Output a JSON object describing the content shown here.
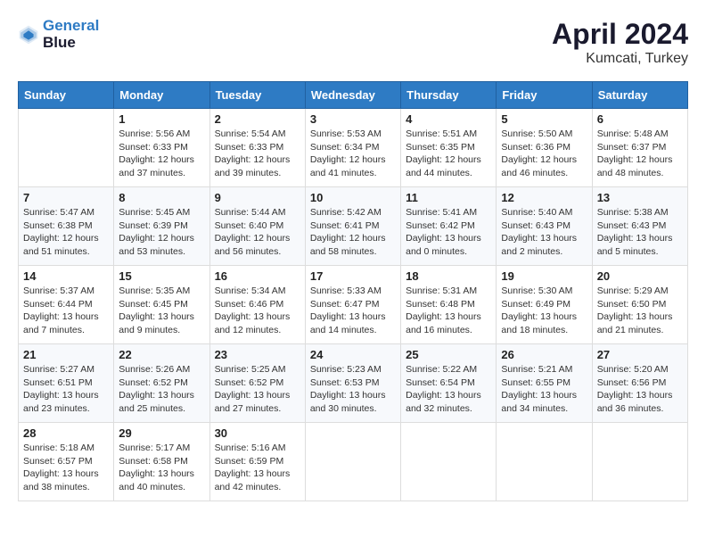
{
  "header": {
    "logo_line1": "General",
    "logo_line2": "Blue",
    "month": "April 2024",
    "location": "Kumcati, Turkey"
  },
  "weekdays": [
    "Sunday",
    "Monday",
    "Tuesday",
    "Wednesday",
    "Thursday",
    "Friday",
    "Saturday"
  ],
  "weeks": [
    [
      {
        "day": "",
        "info": ""
      },
      {
        "day": "1",
        "info": "Sunrise: 5:56 AM\nSunset: 6:33 PM\nDaylight: 12 hours\nand 37 minutes."
      },
      {
        "day": "2",
        "info": "Sunrise: 5:54 AM\nSunset: 6:33 PM\nDaylight: 12 hours\nand 39 minutes."
      },
      {
        "day": "3",
        "info": "Sunrise: 5:53 AM\nSunset: 6:34 PM\nDaylight: 12 hours\nand 41 minutes."
      },
      {
        "day": "4",
        "info": "Sunrise: 5:51 AM\nSunset: 6:35 PM\nDaylight: 12 hours\nand 44 minutes."
      },
      {
        "day": "5",
        "info": "Sunrise: 5:50 AM\nSunset: 6:36 PM\nDaylight: 12 hours\nand 46 minutes."
      },
      {
        "day": "6",
        "info": "Sunrise: 5:48 AM\nSunset: 6:37 PM\nDaylight: 12 hours\nand 48 minutes."
      }
    ],
    [
      {
        "day": "7",
        "info": "Sunrise: 5:47 AM\nSunset: 6:38 PM\nDaylight: 12 hours\nand 51 minutes."
      },
      {
        "day": "8",
        "info": "Sunrise: 5:45 AM\nSunset: 6:39 PM\nDaylight: 12 hours\nand 53 minutes."
      },
      {
        "day": "9",
        "info": "Sunrise: 5:44 AM\nSunset: 6:40 PM\nDaylight: 12 hours\nand 56 minutes."
      },
      {
        "day": "10",
        "info": "Sunrise: 5:42 AM\nSunset: 6:41 PM\nDaylight: 12 hours\nand 58 minutes."
      },
      {
        "day": "11",
        "info": "Sunrise: 5:41 AM\nSunset: 6:42 PM\nDaylight: 13 hours\nand 0 minutes."
      },
      {
        "day": "12",
        "info": "Sunrise: 5:40 AM\nSunset: 6:43 PM\nDaylight: 13 hours\nand 2 minutes."
      },
      {
        "day": "13",
        "info": "Sunrise: 5:38 AM\nSunset: 6:43 PM\nDaylight: 13 hours\nand 5 minutes."
      }
    ],
    [
      {
        "day": "14",
        "info": "Sunrise: 5:37 AM\nSunset: 6:44 PM\nDaylight: 13 hours\nand 7 minutes."
      },
      {
        "day": "15",
        "info": "Sunrise: 5:35 AM\nSunset: 6:45 PM\nDaylight: 13 hours\nand 9 minutes."
      },
      {
        "day": "16",
        "info": "Sunrise: 5:34 AM\nSunset: 6:46 PM\nDaylight: 13 hours\nand 12 minutes."
      },
      {
        "day": "17",
        "info": "Sunrise: 5:33 AM\nSunset: 6:47 PM\nDaylight: 13 hours\nand 14 minutes."
      },
      {
        "day": "18",
        "info": "Sunrise: 5:31 AM\nSunset: 6:48 PM\nDaylight: 13 hours\nand 16 minutes."
      },
      {
        "day": "19",
        "info": "Sunrise: 5:30 AM\nSunset: 6:49 PM\nDaylight: 13 hours\nand 18 minutes."
      },
      {
        "day": "20",
        "info": "Sunrise: 5:29 AM\nSunset: 6:50 PM\nDaylight: 13 hours\nand 21 minutes."
      }
    ],
    [
      {
        "day": "21",
        "info": "Sunrise: 5:27 AM\nSunset: 6:51 PM\nDaylight: 13 hours\nand 23 minutes."
      },
      {
        "day": "22",
        "info": "Sunrise: 5:26 AM\nSunset: 6:52 PM\nDaylight: 13 hours\nand 25 minutes."
      },
      {
        "day": "23",
        "info": "Sunrise: 5:25 AM\nSunset: 6:52 PM\nDaylight: 13 hours\nand 27 minutes."
      },
      {
        "day": "24",
        "info": "Sunrise: 5:23 AM\nSunset: 6:53 PM\nDaylight: 13 hours\nand 30 minutes."
      },
      {
        "day": "25",
        "info": "Sunrise: 5:22 AM\nSunset: 6:54 PM\nDaylight: 13 hours\nand 32 minutes."
      },
      {
        "day": "26",
        "info": "Sunrise: 5:21 AM\nSunset: 6:55 PM\nDaylight: 13 hours\nand 34 minutes."
      },
      {
        "day": "27",
        "info": "Sunrise: 5:20 AM\nSunset: 6:56 PM\nDaylight: 13 hours\nand 36 minutes."
      }
    ],
    [
      {
        "day": "28",
        "info": "Sunrise: 5:18 AM\nSunset: 6:57 PM\nDaylight: 13 hours\nand 38 minutes."
      },
      {
        "day": "29",
        "info": "Sunrise: 5:17 AM\nSunset: 6:58 PM\nDaylight: 13 hours\nand 40 minutes."
      },
      {
        "day": "30",
        "info": "Sunrise: 5:16 AM\nSunset: 6:59 PM\nDaylight: 13 hours\nand 42 minutes."
      },
      {
        "day": "",
        "info": ""
      },
      {
        "day": "",
        "info": ""
      },
      {
        "day": "",
        "info": ""
      },
      {
        "day": "",
        "info": ""
      }
    ]
  ]
}
